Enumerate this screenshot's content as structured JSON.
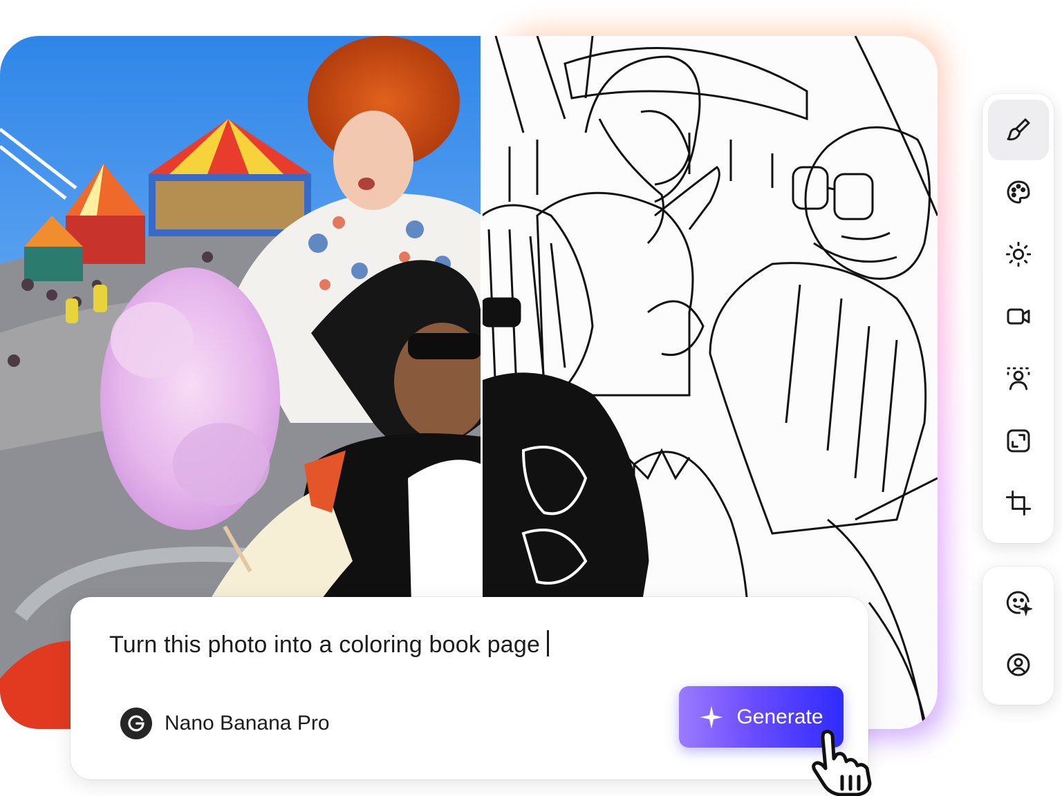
{
  "prompt": {
    "text": "Turn this photo into a coloring book page",
    "model_name": "Nano Banana Pro",
    "model_icon": "google-g-icon",
    "generate_label": "Generate",
    "generate_icon": "sparkle-icon"
  },
  "colors": {
    "accent_start": "#9b7bff",
    "accent_end": "#2f2bff",
    "glow_top": "#ffd3b6",
    "glow_bottom": "#c9a2ff"
  },
  "toolbar": {
    "tools": [
      {
        "icon": "paint-brush-icon",
        "active": true
      },
      {
        "icon": "palette-icon",
        "active": false
      },
      {
        "icon": "sun-icon",
        "active": false
      },
      {
        "icon": "video-camera-icon",
        "active": false
      },
      {
        "icon": "background-remove-icon",
        "active": false
      },
      {
        "icon": "expand-icon",
        "active": false
      },
      {
        "icon": "crop-icon",
        "active": false
      }
    ],
    "secondary_tools": [
      {
        "icon": "face-sparkle-icon"
      },
      {
        "icon": "user-circle-icon"
      }
    ]
  }
}
